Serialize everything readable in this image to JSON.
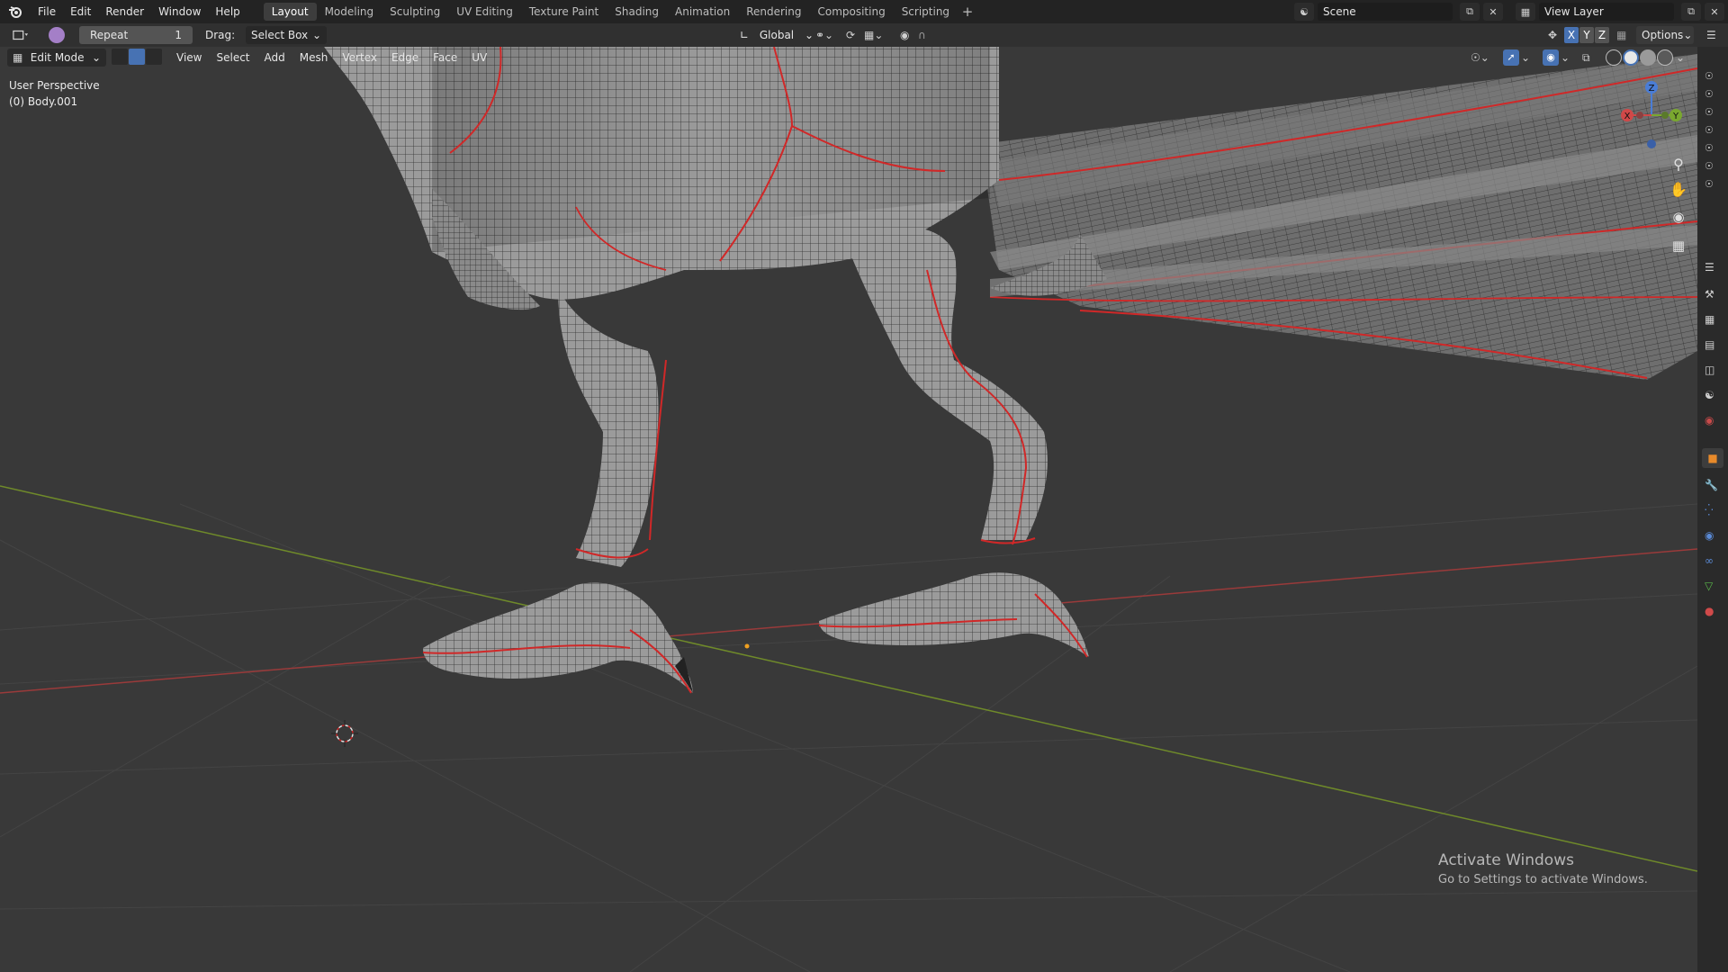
{
  "menu": [
    "File",
    "Edit",
    "Render",
    "Window",
    "Help"
  ],
  "workspaces": [
    "Layout",
    "Modeling",
    "Sculpting",
    "UV Editing",
    "Texture Paint",
    "Shading",
    "Animation",
    "Rendering",
    "Compositing",
    "Scripting"
  ],
  "active_workspace": "Layout",
  "add_tab": "+",
  "scene": {
    "name": "Scene",
    "view_layer": "View Layer"
  },
  "tool": {
    "repeat_label": "Repeat",
    "repeat_value": "1",
    "drag_label": "Drag:",
    "drag_value": "Select Box",
    "orientation": "Global",
    "options_label": "Options",
    "axes": [
      "X",
      "Y",
      "Z"
    ]
  },
  "viewport_header": {
    "mode": "Edit Mode",
    "menus": [
      "View",
      "Select",
      "Add",
      "Mesh",
      "Vertex",
      "Edge",
      "Face",
      "UV"
    ]
  },
  "viewport_info": {
    "perspective": "User Perspective",
    "object": "(0) Body.001"
  },
  "gizmo": {
    "x": "X",
    "y": "Y",
    "z": "Z"
  },
  "watermark": {
    "title": "Activate Windows",
    "subtitle": "Go to Settings to activate Windows."
  },
  "colors": {
    "accent": "#4772b3",
    "seam": "#e03030",
    "x_axis": "#a03838",
    "y_axis": "#6f8a2a"
  }
}
